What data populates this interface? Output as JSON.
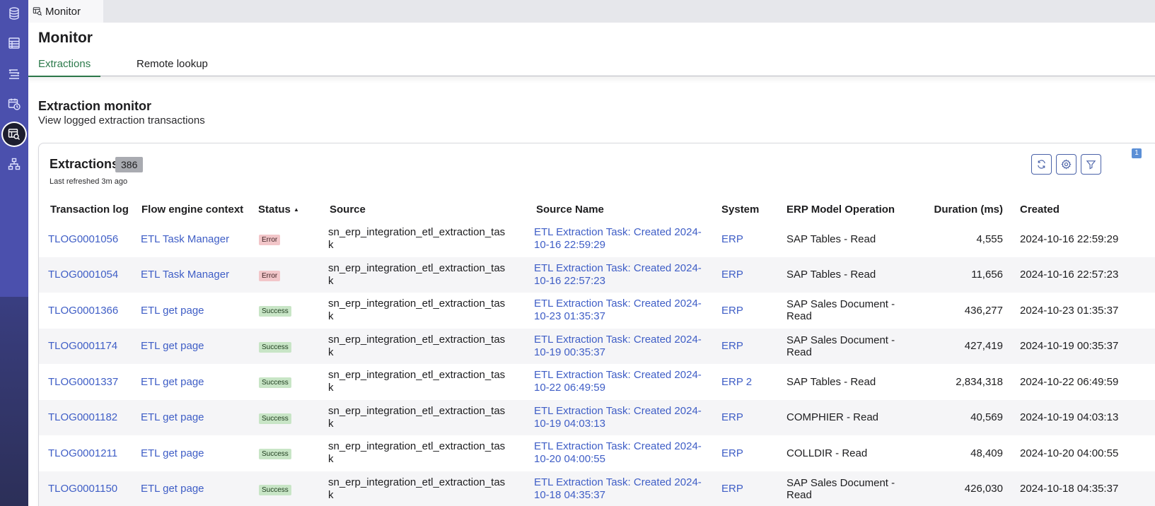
{
  "tab": {
    "label": "Monitor"
  },
  "page": {
    "title": "Monitor"
  },
  "subtabs": [
    {
      "label": "Extractions"
    },
    {
      "label": "Remote lookup"
    }
  ],
  "section": {
    "title": "Extraction monitor",
    "subtitle": "View logged extraction transactions"
  },
  "card": {
    "title": "Extractions",
    "count": "386",
    "refreshed": "Last refreshed 3m ago",
    "filter_count": "1"
  },
  "table": {
    "columns": [
      "Transaction log",
      "Flow engine context",
      "Status",
      "Source",
      "Source Name",
      "System",
      "ERP Model Operation",
      "Duration (ms)",
      "Created"
    ],
    "sort_indicator": "▲",
    "rows": [
      {
        "log": "TLOG0001056",
        "context": "ETL Task Manager",
        "status": "Error",
        "status_type": "error",
        "source_1": "sn_erp_integration_etl_extraction_tas",
        "source_2": "k",
        "name_1": "ETL Extraction Task: Created 2024-",
        "name_2": "10-16 22:59:29",
        "system": "ERP",
        "operation": "SAP Tables - Read",
        "duration": "4,555",
        "created": "2024-10-16 22:59:29"
      },
      {
        "log": "TLOG0001054",
        "context": "ETL Task Manager",
        "status": "Error",
        "status_type": "error",
        "source_1": "sn_erp_integration_etl_extraction_tas",
        "source_2": "k",
        "name_1": "ETL Extraction Task: Created 2024-",
        "name_2": "10-16 22:57:23",
        "system": "ERP",
        "operation": "SAP Tables - Read",
        "duration": "11,656",
        "created": "2024-10-16 22:57:23"
      },
      {
        "log": "TLOG0001366",
        "context": "ETL get page",
        "status": "Success",
        "status_type": "success",
        "source_1": "sn_erp_integration_etl_extraction_tas",
        "source_2": "k",
        "name_1": "ETL Extraction Task: Created 2024-",
        "name_2": "10-23 01:35:37",
        "system": "ERP",
        "operation": "SAP Sales Document - Read",
        "duration": "436,277",
        "created": "2024-10-23 01:35:37"
      },
      {
        "log": "TLOG0001174",
        "context": "ETL get page",
        "status": "Success",
        "status_type": "success",
        "source_1": "sn_erp_integration_etl_extraction_tas",
        "source_2": "k",
        "name_1": "ETL Extraction Task: Created 2024-",
        "name_2": "10-19 00:35:37",
        "system": "ERP",
        "operation": "SAP Sales Document - Read",
        "duration": "427,419",
        "created": "2024-10-19 00:35:37"
      },
      {
        "log": "TLOG0001337",
        "context": "ETL get page",
        "status": "Success",
        "status_type": "success",
        "source_1": "sn_erp_integration_etl_extraction_tas",
        "source_2": "k",
        "name_1": "ETL Extraction Task: Created 2024-",
        "name_2": "10-22 06:49:59",
        "system": "ERP 2",
        "operation": "SAP Tables - Read",
        "duration": "2,834,318",
        "created": "2024-10-22 06:49:59"
      },
      {
        "log": "TLOG0001182",
        "context": "ETL get page",
        "status": "Success",
        "status_type": "success",
        "source_1": "sn_erp_integration_etl_extraction_tas",
        "source_2": "k",
        "name_1": "ETL Extraction Task: Created 2024-",
        "name_2": "10-19 04:03:13",
        "system": "ERP",
        "operation": "COMPHIER - Read",
        "duration": "40,569",
        "created": "2024-10-19 04:03:13"
      },
      {
        "log": "TLOG0001211",
        "context": "ETL get page",
        "status": "Success",
        "status_type": "success",
        "source_1": "sn_erp_integration_etl_extraction_tas",
        "source_2": "k",
        "name_1": "ETL Extraction Task: Created 2024-",
        "name_2": "10-20 04:00:55",
        "system": "ERP",
        "operation": "COLLDIR - Read",
        "duration": "48,409",
        "created": "2024-10-20 04:00:55"
      },
      {
        "log": "TLOG0001150",
        "context": "ETL get page",
        "status": "Success",
        "status_type": "success",
        "source_1": "sn_erp_integration_etl_extraction_tas",
        "source_2": "k",
        "name_1": "ETL Extraction Task: Created 2024-",
        "name_2": "10-18 04:35:37",
        "system": "ERP",
        "operation": "SAP Sales Document - Read",
        "duration": "426,030",
        "created": "2024-10-18 04:35:37"
      }
    ]
  },
  "icons": {
    "rail": [
      "database-icon",
      "table-icon",
      "layers-icon",
      "calendar-clock-icon",
      "monitor-search-icon",
      "hierarchy-icon"
    ],
    "toolbar": [
      "refresh-icon",
      "gear-icon",
      "filter-icon"
    ]
  },
  "colors": {
    "accent_green": "#2c7a4b",
    "link_blue": "#3f5ec6",
    "rail": "#4b50ad",
    "error_bg": "#f2c6c9",
    "success_bg": "#c8e5c6"
  }
}
